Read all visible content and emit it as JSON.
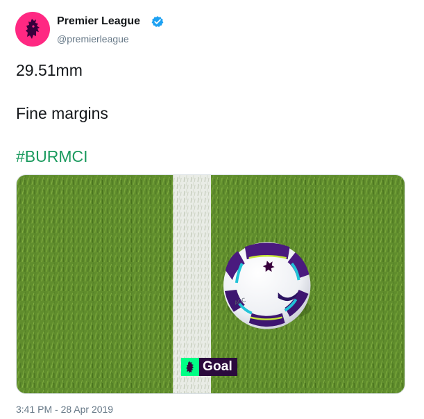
{
  "author": {
    "name": "Premier League",
    "handle": "@premierleague",
    "verified": true,
    "avatar_icon": "premier-league-lion-icon",
    "avatar_color": "#ff2882"
  },
  "tweet": {
    "line1": "29.51mm",
    "line2": "Fine margins",
    "hashtag": "#BURMCI"
  },
  "media": {
    "badge_text": "Goal",
    "badge_icon": "premier-league-lion-icon",
    "badge_colors": {
      "background": "#2b0a3d",
      "logo": "#00ff85"
    },
    "ball_icon": "football-icon"
  },
  "timestamp": "3:41 PM - 28 Apr 2019",
  "colors": {
    "hashtag": "#1b9a5e",
    "verified": "#1da1f2",
    "secondary_text": "#657786"
  }
}
